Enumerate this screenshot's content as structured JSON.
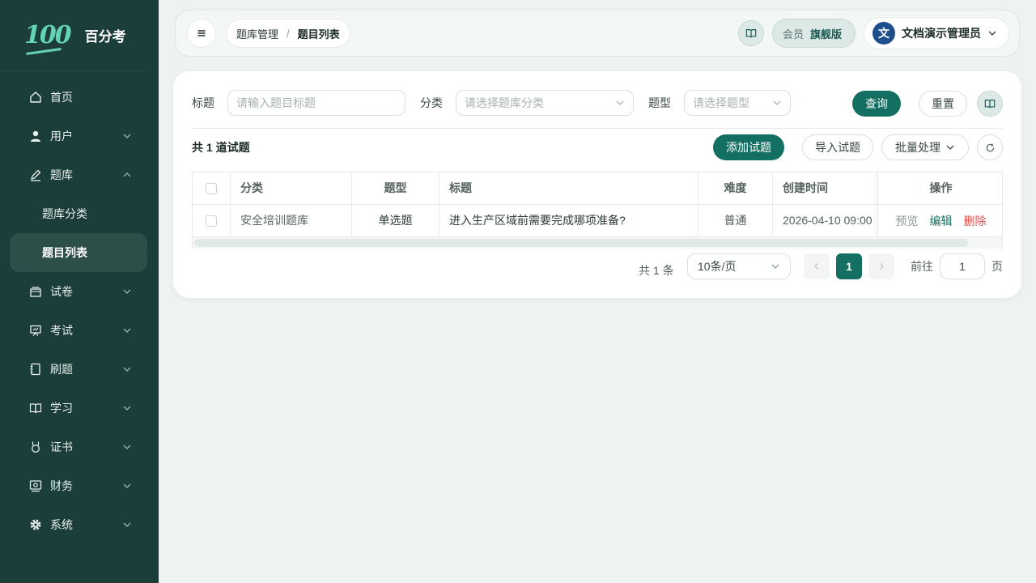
{
  "brand": {
    "logo_mark": "100",
    "name": "百分考"
  },
  "sidebar": {
    "items": [
      {
        "label": "首页",
        "icon": "home-icon"
      },
      {
        "label": "用户",
        "icon": "user-icon"
      },
      {
        "label": "题库",
        "icon": "pen-icon"
      },
      {
        "label": "试卷",
        "icon": "inbox-icon"
      },
      {
        "label": "考试",
        "icon": "presentation-icon"
      },
      {
        "label": "刷题",
        "icon": "notebook-icon"
      },
      {
        "label": "学习",
        "icon": "book-open-icon"
      },
      {
        "label": "证书",
        "icon": "medal-icon"
      },
      {
        "label": "财务",
        "icon": "finance-icon"
      },
      {
        "label": "系统",
        "icon": "gear-icon"
      }
    ],
    "sub_items": [
      {
        "label": "题库分类"
      },
      {
        "label": "题目列表",
        "active": true
      }
    ]
  },
  "header": {
    "breadcrumb": [
      "题库管理",
      "题目列表"
    ],
    "breadcrumb_sep": "/",
    "member_label": "会员",
    "member_level": "旗舰版",
    "avatar_text": "文",
    "user_name": "文档演示管理员"
  },
  "filters": {
    "title_label": "标题",
    "title_placeholder": "请输入题目标题",
    "category_label": "分类",
    "category_placeholder": "请选择题库分类",
    "type_label": "题型",
    "type_placeholder": "请选择题型",
    "search_button": "查询",
    "reset_button": "重置"
  },
  "toolbar": {
    "count_text": "共 1 道试题",
    "add_button": "添加试题",
    "import_button": "导入试题",
    "batch_button": "批量处理"
  },
  "table": {
    "columns": [
      "分类",
      "题型",
      "标题",
      "难度",
      "创建时间",
      "操作"
    ],
    "rows": [
      {
        "category": "安全培训题库",
        "type": "单选题",
        "title": "进入生产区域前需要完成哪项准备?",
        "difficulty": "普通",
        "created": "2026-04-10 09:00",
        "actions": [
          "预览",
          "编辑",
          "删除"
        ]
      }
    ]
  },
  "pagination": {
    "total_text": "共 1 条",
    "page_size": "10条/页",
    "current_page": "1",
    "goto_label": "前往",
    "goto_value": "1",
    "goto_suffix": "页"
  },
  "colors": {
    "sidebar_bg": "#1c3e3a",
    "primary": "#136f61",
    "danger": "#d9534f",
    "page_bg": "#eef2f1"
  }
}
